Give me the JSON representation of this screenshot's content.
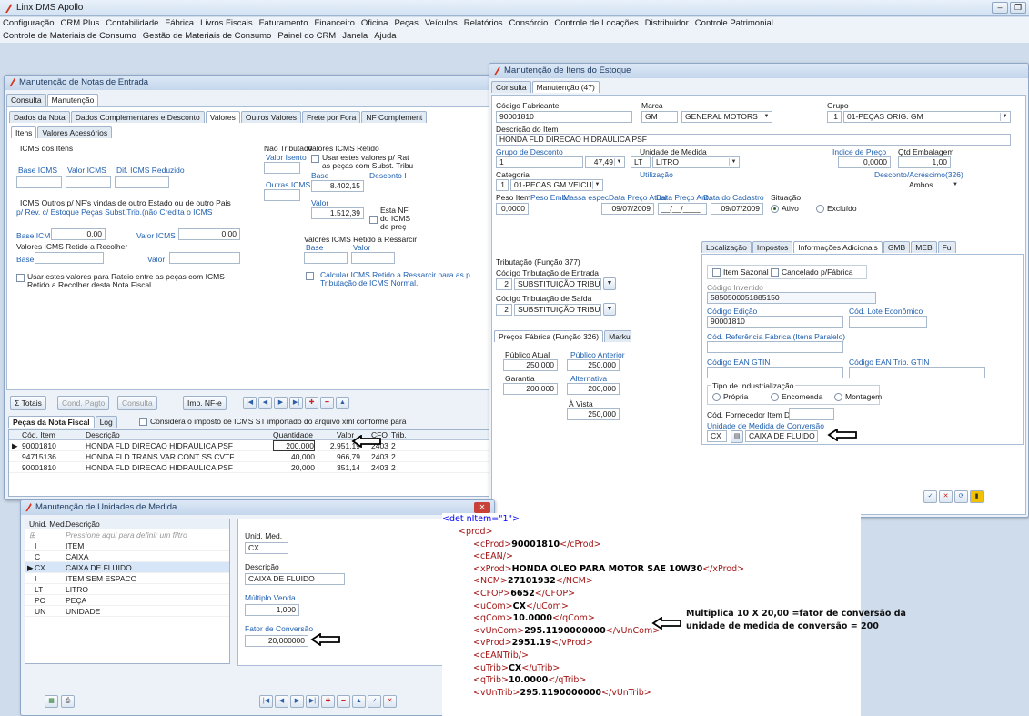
{
  "app": {
    "title": "Linx DMS Apollo"
  },
  "menu": {
    "row1": [
      "Configuração",
      "CRM Plus",
      "Contabilidade",
      "Fábrica",
      "Livros Fiscais",
      "Faturamento",
      "Financeiro",
      "Oficina",
      "Peças",
      "Veículos",
      "Relatórios",
      "Consórcio",
      "Controle de Locações",
      "Distribuidor",
      "Controle Patrimonial"
    ],
    "row2": [
      "Controle de Materiais de Consumo",
      "Gestão de Materiais de Consumo",
      "Painel do CRM",
      "Janela",
      "Ajuda"
    ]
  },
  "nota": {
    "title": "Manutenção de Notas de Entrada",
    "tabs": [
      "Consulta",
      "Manutenção"
    ],
    "subtabs": [
      "Dados da Nota",
      "Dados Complementares e Desconto",
      "Valores",
      "Outros Valores",
      "Frete por Fora",
      "NF Complement"
    ],
    "innertabs": [
      "Itens",
      "Valores Acessórios"
    ],
    "icms_itens": "ICMS dos Itens",
    "base_icms": "Base ICMS",
    "valor_icms": "Valor ICMS",
    "dif_icms": "Dif. ICMS Reduzido",
    "nao_tributado": "Não Tributado",
    "valor_isento": "Valor Isento",
    "outras_icms": "Outras ICMS",
    "retido_title": "Valores ICMS Retido",
    "usar_retido": "Usar estes valores p/ Rat",
    "usar_retido2": "as peças com Subst. Tribu",
    "base": "Base",
    "desconto": "Desconto I",
    "base_val": "8.402,15",
    "valor": "Valor",
    "valor_val": "1.512,39",
    "esta_nf": "Esta NF",
    "esta_nf2": "do ICMS",
    "esta_nf3": "de preç",
    "icms_outros": "ICMS Outros p/ NF's vindas de outro Estado ou de outro Pais",
    "icms_outros2": "p/ Rev. c/ Estoque Peças Subst.Trib.(não Credita o ICMS",
    "base_icms2": "Base ICMS",
    "base_icms2_val": "0,00",
    "valor_icms2": "Valor ICMS",
    "valor_icms2_val": "0,00",
    "ressarcir": "Valores ICMS Retido a Ressarcir",
    "ressarcir_base": "Base",
    "ressarcir_valor": "Valor",
    "retido_recolher": "Valores ICMS Retido a Recolher",
    "rec_base": "Base",
    "rec_valor": "Valor",
    "usar_rateio": "Usar estes valores para Rateio entre as peças com ICMS",
    "usar_rateio2": "Retido a Recolher desta Nota Fiscal.",
    "calcular": "Calcular ICMS Retido a Ressarcir para as p",
    "calcular2": "Tributação de ICMS Normal.",
    "btn_totais": "Totais",
    "btn_cond": "Cond. Pagto",
    "btn_consulta": "Consulta",
    "btn_imp": "Imp. NF-e",
    "pecas_title": "Peças da Nota Fiscal",
    "log_tab": "Log",
    "considera": "Considera o imposto de ICMS ST importado do arquivo xml conforme para",
    "headers": [
      "Cód. Item",
      "Descrição",
      "Quantidade",
      "Valor",
      "CFO",
      "Trib."
    ],
    "rows": [
      [
        "90001810",
        "HONDA FLD DIRECAO HIDRAULICA PSF",
        "200,000",
        "2.951,19",
        "2403",
        "2"
      ],
      [
        "94715136",
        "HONDA FLD TRANS VAR CONT SS CVTF",
        "40,000",
        "966,79",
        "2403",
        "2"
      ],
      [
        "90001810",
        "HONDA FLD DIRECAO HIDRAULICA PSF",
        "20,000",
        "351,14",
        "2403",
        "2"
      ]
    ]
  },
  "estoque": {
    "title": "Manutenção de Itens do Estoque",
    "tabs": [
      "Consulta",
      "Manutenção (47)"
    ],
    "codigo_fabricante": "Código Fabricante",
    "codigo_fabricante_val": "90001810",
    "marca": "Marca",
    "marca_val": "GM",
    "marca_nome": "GENERAL MOTORS",
    "grupo": "Grupo",
    "grupo_num": "1",
    "grupo_val": "01-PEÇAS ORIG. GM",
    "descricao_item": "Descrição do Item",
    "descricao_item_val": "HONDA FLD DIRECAO HIDRAULICA PSF",
    "grupo_desconto": "Grupo de Desconto",
    "grupo_desconto_num": "1",
    "grupo_desconto_val": "47,49",
    "unidade": "Unidade de Medida",
    "unidade_cod": "LT",
    "unidade_val": "LITRO",
    "indice_preco": "Indice de Preço",
    "indice_preco_val": "0,0000",
    "qtd_emb": "Qtd Embalagem",
    "qtd_emb_val": "1,00",
    "categoria": "Categoria",
    "categoria_num": "1",
    "categoria_val": "01-PECAS GM VEICUL",
    "utilizacao": "Utilização",
    "desconto_acrescimo": "Desconto/Acréscimo(326)",
    "ambos": "Ambos",
    "peso_item": "Peso Item",
    "peso_item_val": "0,0000",
    "peso_emb": "Peso Emb.",
    "massa": "Massa espec.",
    "data_preco": "Data Preço Atual",
    "data_preco_val": "09/07/2009",
    "data_preco_ant": "Data Preço Ant.",
    "data_preco_ant_val": "__/__/____",
    "data_cadastro": "Data do Cadastro",
    "data_cadastro_val": "09/07/2009",
    "situacao": "Situação",
    "ativo": "Ativo",
    "excluido": "Excluído",
    "tabs2": [
      "Localização",
      "Impostos",
      "Informações Adicionais",
      "GMB",
      "MEB",
      "Fu"
    ],
    "item_sazonal": "Item Sazonal",
    "cancelado": "Cancelado p/Fábrica",
    "codigo_invertido": "Código Invertido",
    "codigo_invertido_val": "5850500051885150",
    "codigo_edicao": "Código Edição",
    "codigo_edicao_val": "90001810",
    "cod_lote": "Cód. Lote Econômico",
    "cod_ref": "Cód. Referência Fábrica (Itens Paralelo)",
    "ean": "Código EAN GTIN",
    "ean_trib": "Código EAN Trib. GTIN",
    "tipo_ind": "Tipo de Industrialização",
    "propria": "Própria",
    "encomenda": "Encomenda",
    "montagem": "Montagem",
    "cod_forn": "Cód. Fornecedor Item DSH",
    "unid_conv": "Unidade de Medida de Conversão",
    "unid_conv_cod": "CX",
    "unid_conv_val": "CAIXA DE FLUIDO",
    "tributacao": "Tributação (Função 377)",
    "trib_entrada": "Código Tributação de Entrada",
    "trib_entrada_num": "2",
    "trib_entrada_val": "SUBSTITUIÇÃO TRIBUTÁRIA",
    "trib_saida": "Código Tributação de Saída",
    "trib_saida_num": "2",
    "trib_saida_val": "SUBSTITUIÇÃO TRIBUTÁRIA",
    "precos_tabs": [
      "Preços Fábrica (Função 326)",
      "Markup (Fu"
    ],
    "publico_atual": "Público Atual",
    "publico_atual_val": "250,000",
    "publico_anterior": "Público Anterior",
    "publico_anterior_val": "250,000",
    "garantia": "Garantia",
    "garantia_val": "200,000",
    "alternativa": "Alternativa",
    "alternativa_val": "200,000",
    "a_vista": "À Vista",
    "a_vista_val": "250,000"
  },
  "unidades": {
    "title": "Manutenção de Unidades de Medida",
    "col1": "Unid. Med.",
    "col2": "Descrição",
    "filter": "Pressione aqui para definir um filtro",
    "rows": [
      [
        "I",
        "ITEM"
      ],
      [
        "C",
        "CAIXA"
      ],
      [
        "CX",
        "CAIXA DE FLUIDO"
      ],
      [
        "I",
        "ITEM SEM ESPACO"
      ],
      [
        "LT",
        "LITRO"
      ],
      [
        "PC",
        "PEÇA"
      ],
      [
        "UN",
        "UNIDADE"
      ]
    ],
    "unid_med": "Unid. Med.",
    "unid_med_val": "CX",
    "descricao": "Descrição",
    "descricao_val": "CAIXA DE FLUIDO",
    "multiplo": "Múltiplo Venda",
    "multiplo_val": "1,000",
    "fator": "Fator de Conversão",
    "fator_val": "20,000000"
  },
  "xml": {
    "det_tag": "<det nItem=\"1\">",
    "lines": [
      {
        "pre": "<prod>",
        "val": "",
        "post": ""
      },
      {
        "pre": "<cProd>",
        "val": "90001810",
        "post": "</cProd>"
      },
      {
        "pre": "<cEAN/>",
        "val": "",
        "post": ""
      },
      {
        "pre": "<xProd>",
        "val": "HONDA OLEO PARA MOTOR SAE 10W30",
        "post": "</xProd>"
      },
      {
        "pre": "<NCM>",
        "val": "27101932",
        "post": "</NCM>"
      },
      {
        "pre": "<CFOP>",
        "val": "6652",
        "post": "</CFOP>"
      },
      {
        "pre": "<uCom>",
        "val": "CX",
        "post": "</uCom>"
      },
      {
        "pre": "<qCom>",
        "val": "10.0000",
        "post": "</qCom>"
      },
      {
        "pre": "<vUnCom>",
        "val": "295.1190000000",
        "post": "</vUnCom>"
      },
      {
        "pre": "<vProd>",
        "val": "2951.19",
        "post": "</vProd>"
      },
      {
        "pre": "<cEANTrib/>",
        "val": "",
        "post": ""
      },
      {
        "pre": "<uTrib>",
        "val": "CX",
        "post": "</uTrib>"
      },
      {
        "pre": "<qTrib>",
        "val": "10.0000",
        "post": "</qTrib>"
      },
      {
        "pre": "<vUnTrib>",
        "val": "295.1190000000",
        "post": "</vUnTrib>"
      }
    ],
    "note1": "Multiplica 10 X 20,00 =fator de conversão da",
    "note2": "unidade de medida de conversão = 200"
  },
  "colors": {
    "arrow": "#000000",
    "label_blue": "#1f5fb0",
    "xml_tag": "#a31515",
    "xml_bracket": "#0000ff"
  }
}
